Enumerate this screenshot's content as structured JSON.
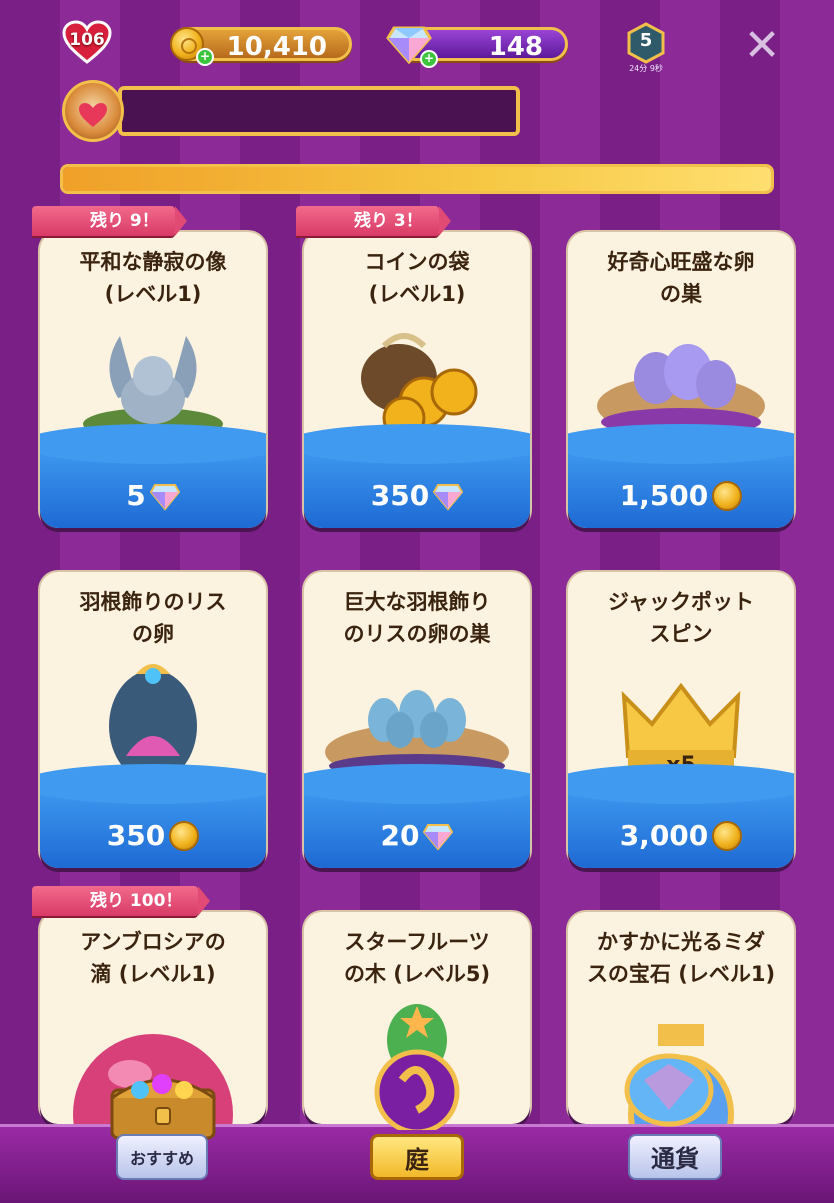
{
  "header": {
    "hearts": "106",
    "coins": "10,410",
    "gems": "148",
    "level": "5",
    "level_sub": "24分 9秒",
    "close_label": "✕"
  },
  "event": {
    "name": "",
    "progress_fraction": 1.0
  },
  "cards": [
    {
      "ribbon": "残り 9！",
      "title": "平和な静寂の像\n(レベル1)",
      "price": "5",
      "currency": "gem"
    },
    {
      "ribbon": "残り 3！",
      "title": "コインの袋\n(レベル1)",
      "price": "350",
      "currency": "gem"
    },
    {
      "ribbon": "",
      "title": "好奇心旺盛な卵\nの巣",
      "price": "1,500",
      "currency": "coin"
    },
    {
      "ribbon": "",
      "title": "羽根飾りのリス\nの卵",
      "price": "350",
      "currency": "coin"
    },
    {
      "ribbon": "",
      "title": "巨大な羽根飾り\nのリスの卵の巣",
      "price": "20",
      "currency": "gem"
    },
    {
      "ribbon": "",
      "title": "ジャックポット\nスピン",
      "price": "3,000",
      "currency": "coin",
      "qty": "x5"
    },
    {
      "ribbon": "残り 100！",
      "title": "アンブロシアの\n滴 (レベル1)",
      "price": "",
      "currency": ""
    },
    {
      "ribbon": "",
      "title": "スターフルーツ\nの木 (レベル5)",
      "price": "",
      "currency": ""
    },
    {
      "ribbon": "",
      "title": "かすかに光るミダ\nスの宝石 (レベル1)",
      "price": "",
      "currency": ""
    }
  ],
  "nav": {
    "recommended": "おすすめ",
    "garden": "庭",
    "currency": "通貨"
  },
  "colors": {
    "accent_gold": "#f2c04a",
    "card_blue": "#3f9af0",
    "ribbon_pink": "#e04a74"
  }
}
